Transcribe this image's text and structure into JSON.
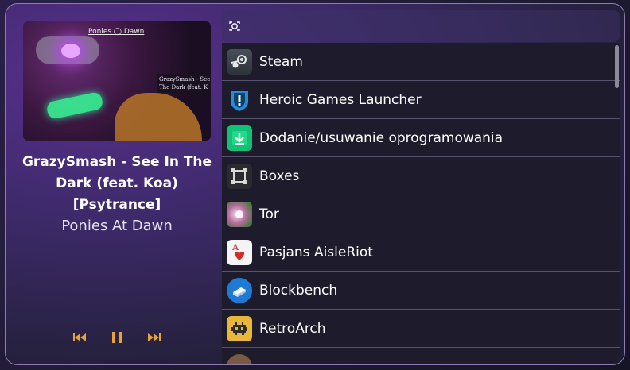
{
  "player": {
    "art_logo": "Ponies ◯ Dawn",
    "art_caption_line1": "GrazySmash - See",
    "art_caption_line2": "The Dark (feat. K",
    "title": "GrazySmash - See In The Dark (feat. Koa) [Psytrance]",
    "artist": "Ponies At Dawn",
    "controls": {
      "prev_icon": "skip-previous-icon",
      "pause_icon": "pause-icon",
      "next_icon": "skip-next-icon",
      "color": "#e8a23a"
    }
  },
  "search": {
    "value": "",
    "placeholder": "",
    "icon": "search-icon"
  },
  "apps": [
    {
      "label": "Steam",
      "icon": "steam-icon"
    },
    {
      "label": "Heroic Games Launcher",
      "icon": "heroic-icon"
    },
    {
      "label": "Dodanie/usuwanie oprogramowania",
      "icon": "software-center-icon"
    },
    {
      "label": "Boxes",
      "icon": "boxes-icon"
    },
    {
      "label": "Tor",
      "icon": "tor-icon"
    },
    {
      "label": "Pasjans AisleRiot",
      "icon": "aisleriot-icon"
    },
    {
      "label": "Blockbench",
      "icon": "blockbench-icon"
    },
    {
      "label": "RetroArch",
      "icon": "retroarch-icon"
    }
  ],
  "colors": {
    "accent": "#e8a23a",
    "list_bg": "#1e1c2c",
    "divider": "#58536c"
  }
}
